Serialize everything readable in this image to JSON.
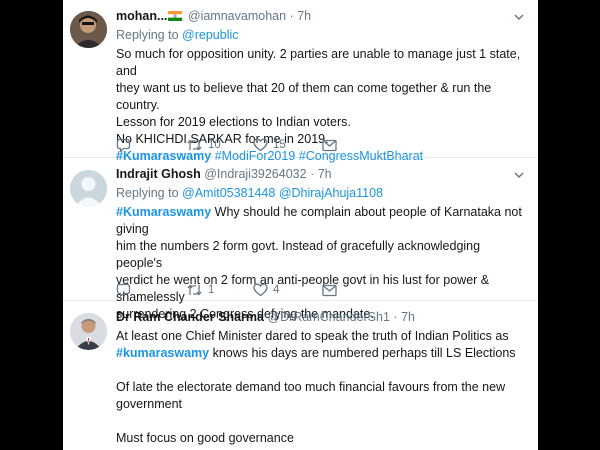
{
  "tweets": [
    {
      "display_name": "mohan...",
      "handle": "@iamnavamohan",
      "separator": "·",
      "time": "7h",
      "replying_label": "Replying to",
      "replying_to": [
        "@republic"
      ],
      "body_lines": [
        "So much for opposition unity. 2 parties are unable to manage just 1 state, and",
        "they want us to believe that 20 of them can come together & run the country.",
        "Lesson for 2019 elections to Indian voters.",
        "No KHICHDI SARKAR for me in 2019."
      ],
      "hashtags": [
        "#Kumaraswamy",
        "#ModiFor2019",
        "#CongressMuktBharat"
      ],
      "retweets": "10",
      "likes": "15"
    },
    {
      "display_name": "Indrajit Ghosh",
      "handle": "@Indraji39264032",
      "separator": "·",
      "time": "7h",
      "replying_label": "Replying to",
      "replying_to": [
        "@Amit05381448",
        "@DhirajAhuja1108"
      ],
      "body_hashtag": "#Kumaraswamy",
      "body_first": " Why should he complain about people of Karnataka not giving",
      "body_lines": [
        "him the numbers 2 form govt. Instead of gracefully acknowledging people's",
        "verdict he went on 2 form an anti-people govt in his lust for power & shamelessly",
        "surrendering 2 Congress defying the mandate."
      ],
      "retweets": "1",
      "likes": "4"
    },
    {
      "display_name": "Dr Ram Chander Sharma",
      "handle": "@DrRamChanderSh1",
      "separator": "·",
      "time": "7h",
      "body_first": "At least one Chief Minister dared to speak the truth of Indian Politics as",
      "body_hashtag": "#kumaraswamy",
      "body_second": " knows his days are numbered perhaps till LS Elections",
      "body_lines": [
        "Of late the electorate demand too much financial favours from the new",
        "government"
      ],
      "body_last": "Must focus on good governance"
    }
  ],
  "colors": {
    "link": "#1b95e0",
    "text": "#14171a",
    "muted": "#657786",
    "divider": "#e6ecf0",
    "background": "#000000"
  },
  "icons": [
    "caret-down-icon",
    "reply-icon",
    "retweet-icon",
    "like-icon",
    "message-icon",
    "india-flag-icon"
  ]
}
